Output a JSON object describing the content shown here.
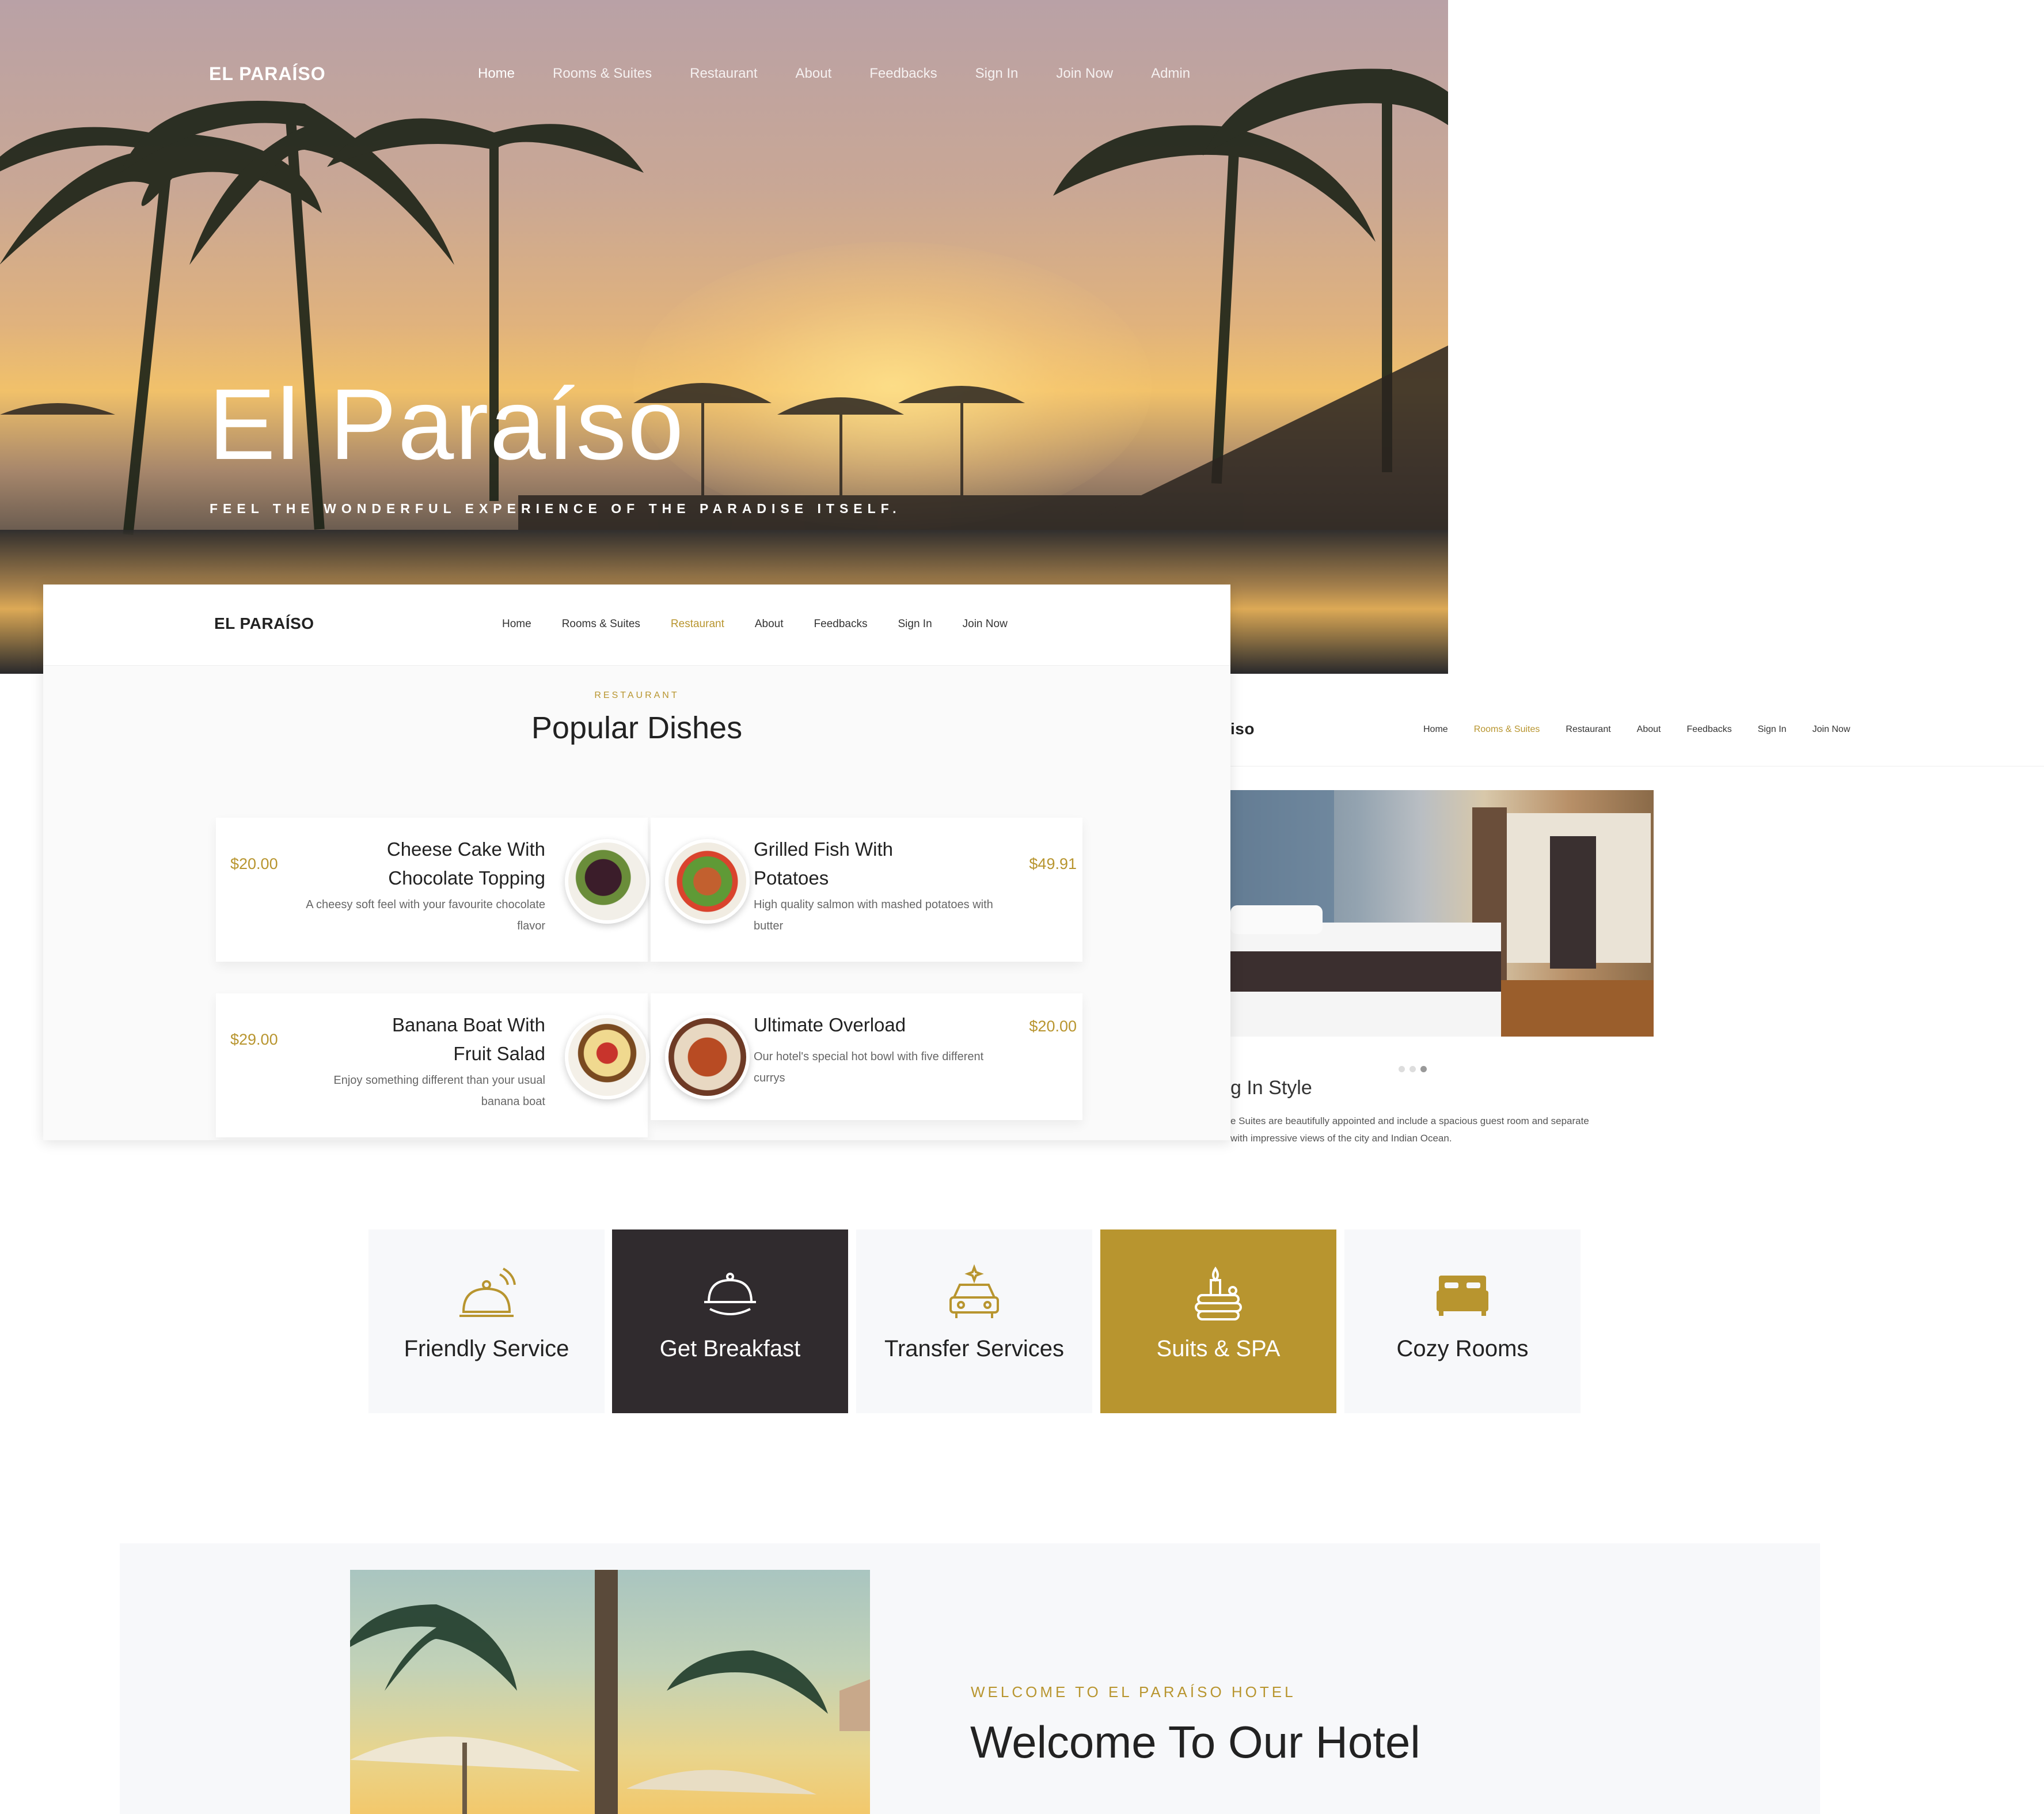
{
  "hero": {
    "brand": "EL PARAÍSO",
    "nav": [
      "Home",
      "Rooms & Suites",
      "Restaurant",
      "About",
      "Feedbacks",
      "Sign In",
      "Join Now",
      "Admin"
    ],
    "active_nav": "Home",
    "title": "El Paraíso",
    "subtitle": "FEEL THE WONDERFUL EXPERIENCE OF THE PARADISE ITSELF."
  },
  "restaurant": {
    "brand": "EL PARAÍSO",
    "nav": [
      "Home",
      "Rooms & Suites",
      "Restaurant",
      "About",
      "Feedbacks",
      "Sign In",
      "Join Now"
    ],
    "active_nav": "Restaurant",
    "eyebrow": "RESTAURANT",
    "title": "Popular Dishes",
    "dishes": [
      {
        "name_line1": "Cheese Cake With",
        "name_line2": "Chocolate Topping",
        "price": "$20.00",
        "desc_line1": "A cheesy soft feel with your favourite chocolate",
        "desc_line2": "flavor"
      },
      {
        "name_line1": "Grilled Fish With",
        "name_line2": "Potatoes",
        "price": "$49.91",
        "desc_line1": "High quality salmon with mashed potatoes with",
        "desc_line2": "butter"
      },
      {
        "name_line1": "Banana Boat With",
        "name_line2": "Fruit Salad",
        "price": "$29.00",
        "desc_line1": "Enjoy something different than your usual",
        "desc_line2": "banana boat"
      },
      {
        "name_line1": "Ultimate Overload",
        "name_line2": "",
        "price": "$20.00",
        "desc_line1": "Our hotel's special hot bowl with five different",
        "desc_line2": "currys"
      }
    ]
  },
  "rooms": {
    "brand_fragment": "iso",
    "nav": [
      "Home",
      "Rooms & Suites",
      "Restaurant",
      "About",
      "Feedbacks",
      "Sign In",
      "Join Now"
    ],
    "active_nav": "Rooms & Suites",
    "heading_fragment": "g In Style",
    "text_line1": "e Suites are beautifully appointed and include a spacious guest room and separate",
    "text_line2": "with impressive views of the city and Indian Ocean."
  },
  "features": [
    {
      "label": "Friendly Service",
      "icon": "service-bell-icon",
      "style": "light"
    },
    {
      "label": "Get Breakfast",
      "icon": "cloche-icon",
      "style": "dark"
    },
    {
      "label": "Transfer Services",
      "icon": "car-icon",
      "style": "light"
    },
    {
      "label": "Suits & SPA",
      "icon": "spa-icon",
      "style": "gold"
    },
    {
      "label": "Cozy Rooms",
      "icon": "bed-icon",
      "style": "light"
    }
  ],
  "welcome": {
    "eyebrow": "WELCOME TO EL PARAÍSO HOTEL",
    "title": "Welcome To Our Hotel"
  },
  "colors": {
    "gold": "#b8952f",
    "dark": "#302b2e",
    "light_bg": "#f7f8fa"
  }
}
